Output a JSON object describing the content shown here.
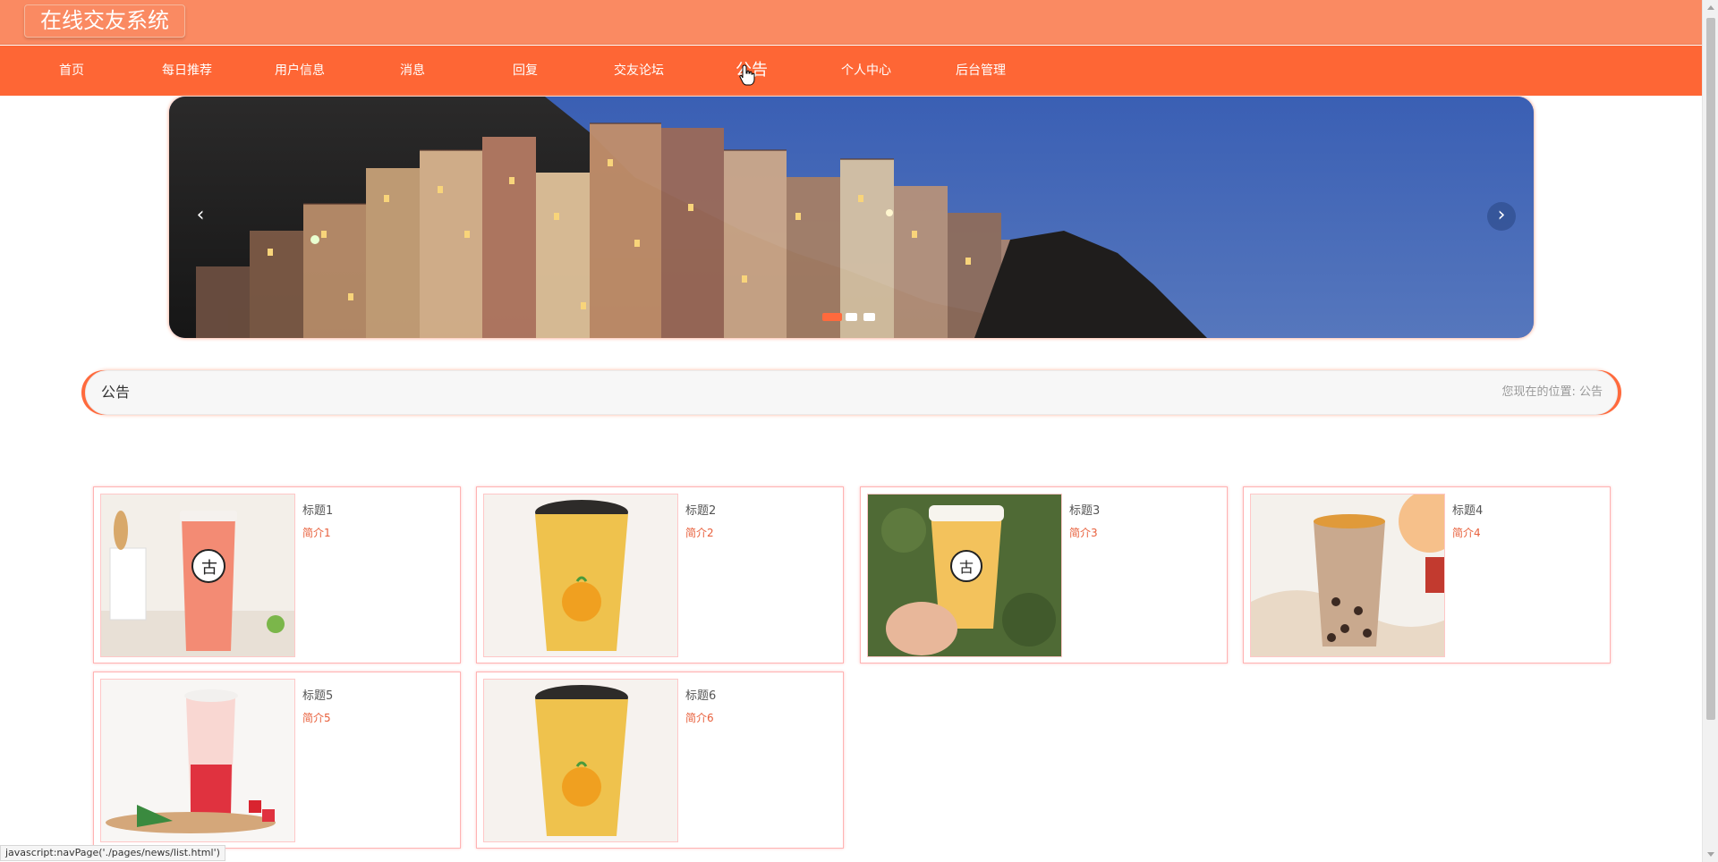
{
  "header": {
    "site_title": "在线交友系统"
  },
  "nav": {
    "items": [
      {
        "label": "首页"
      },
      {
        "label": "每日推荐"
      },
      {
        "label": "用户信息"
      },
      {
        "label": "消息"
      },
      {
        "label": "回复"
      },
      {
        "label": "交友论坛"
      },
      {
        "label": "公告"
      },
      {
        "label": "个人中心"
      },
      {
        "label": "后台管理"
      }
    ],
    "hovered": "公告"
  },
  "banner": {
    "prev_icon": "chevron-left-icon",
    "next_icon": "chevron-right-icon",
    "prev_glyph": "‹",
    "next_glyph": "›",
    "slide_count": 3,
    "active_slide": 1
  },
  "breadcrumb": {
    "title": "公告",
    "location_label": "您现在的位置:",
    "location_value": "公告"
  },
  "cards": [
    {
      "title": "标题1",
      "intro": "简介1",
      "image": "drink-red-tea"
    },
    {
      "title": "标题2",
      "intro": "简介2",
      "image": "drink-orange-boba"
    },
    {
      "title": "标题3",
      "intro": "简介3",
      "image": "drink-held-in-hand"
    },
    {
      "title": "标题4",
      "intro": "简介4",
      "image": "drink-milk-tea-poster"
    },
    {
      "title": "标题5",
      "intro": "简介5",
      "image": "drink-watermelon"
    },
    {
      "title": "标题6",
      "intro": "简介6",
      "image": "drink-orange-boba"
    }
  ],
  "status_bar": {
    "url": "javascript:navPage('./pages/news/list.html')"
  },
  "colors": {
    "header_bg": "#fa8a62",
    "nav_bg": "#fe6635",
    "accent": "#ff6a3d",
    "card_border": "#ffb3b3",
    "intro_text": "#e8603c"
  }
}
